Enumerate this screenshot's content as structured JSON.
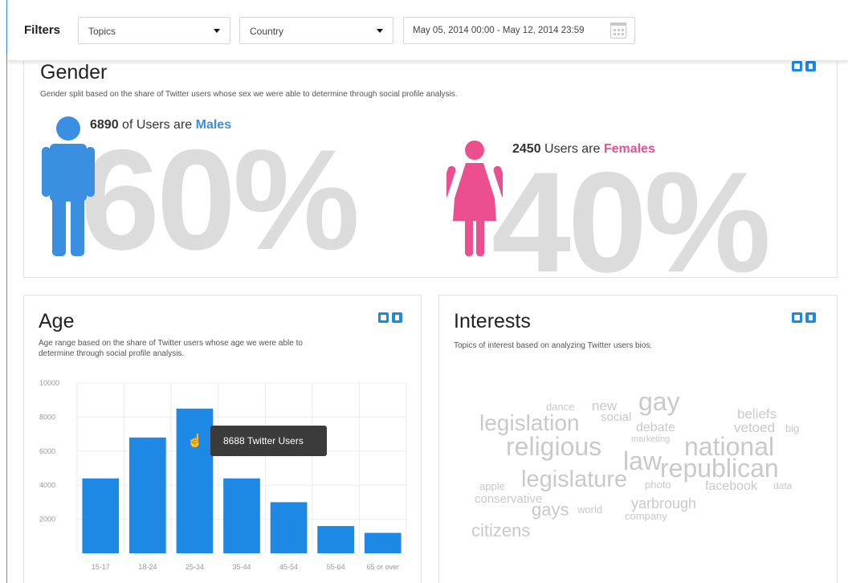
{
  "filter_bar": {
    "label": "Filters",
    "topics": {
      "value": "Topics"
    },
    "country": {
      "value": "Country"
    },
    "date_range": {
      "value": "May 05, 2014 00:00 - May 12, 2014 23:59"
    }
  },
  "gender": {
    "title": "Gender",
    "description": "Gender split based on the share of Twitter users whose sex we were able to determine through social profile analysis.",
    "males": {
      "count": "6890",
      "text": " of Users are ",
      "label": "Males",
      "percent": "60%"
    },
    "females": {
      "count": "2450",
      "text": " Users are ",
      "label": "Females",
      "percent": "40%"
    }
  },
  "age": {
    "title": "Age",
    "description_line1": "Age range based on the share of Twitter users whose age we were able to",
    "description_line2": "determine through social profile analysis.",
    "tooltip": "8688 Twitter Users"
  },
  "interests": {
    "title": "Interests",
    "description": "Topics of interest based on analyzing Twitter users bios.",
    "words": [
      "dance",
      "new",
      "gay",
      "social",
      "beliefs",
      "legislation",
      "debate",
      "vetoed",
      "big",
      "marketing",
      "religious",
      "national",
      "law",
      "republican",
      "apple",
      "legislature",
      "photo",
      "facebook",
      "data",
      "conservative",
      "yarbrough",
      "gays",
      "world",
      "company",
      "citizens"
    ]
  },
  "colors": {
    "accent": "#1e88e5",
    "male": "#3a8fe0",
    "female": "#ec4f8f",
    "bar": "#1e88e5"
  },
  "chart_data": {
    "type": "bar",
    "categories": [
      "15-17",
      "18-24",
      "25-34",
      "35-44",
      "45-54",
      "55-64",
      "65 or over"
    ],
    "values": [
      4400,
      6800,
      8500,
      4400,
      3000,
      1600,
      1200
    ],
    "yticks": [
      "10000",
      "8000",
      "6000",
      "4000",
      "2000"
    ],
    "ylim": [
      0,
      10000
    ],
    "grid": true,
    "title": "",
    "xlabel": "",
    "ylabel": ""
  }
}
